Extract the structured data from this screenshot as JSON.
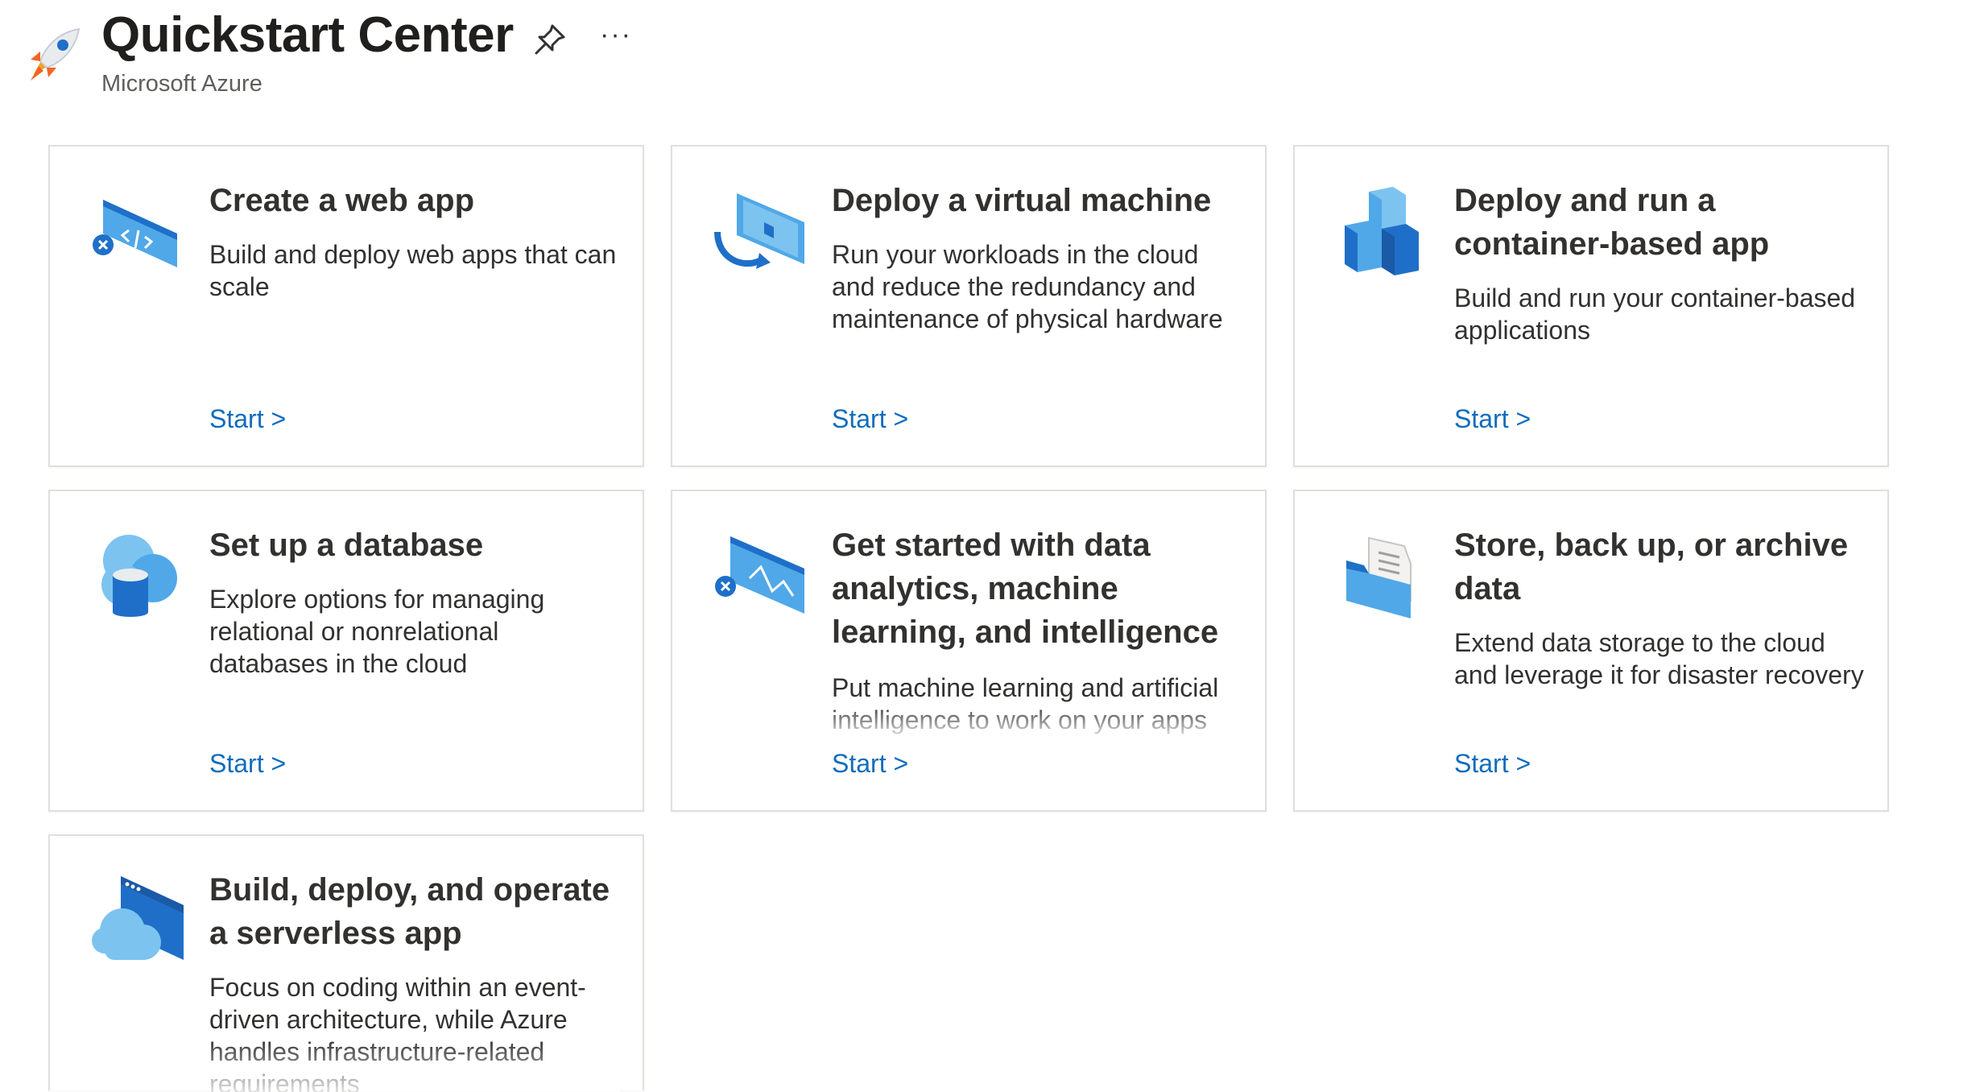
{
  "header": {
    "title": "Quickstart Center",
    "subtitle": "Microsoft Azure",
    "rocket_icon": "rocket-icon",
    "pin_icon": "pin-icon",
    "more_label": "···"
  },
  "cards": [
    {
      "title": "Create a web app",
      "description": "Build and deploy web apps that can scale",
      "start_label": "Start >",
      "icon": "web-app-icon"
    },
    {
      "title": "Deploy a virtual machine",
      "description": "Run your workloads in the cloud and reduce the redundancy and maintenance of physical hardware",
      "start_label": "Start >",
      "icon": "virtual-machine-icon"
    },
    {
      "title": "Deploy and run a container-based app",
      "description": "Build and run your container-based applications",
      "start_label": "Start >",
      "icon": "container-icon"
    },
    {
      "title": "Set up a database",
      "description": "Explore options for managing relational or nonrelational databases in the cloud",
      "start_label": "Start >",
      "icon": "database-icon"
    },
    {
      "title": "Get started with data analytics, machine learning, and intelligence",
      "description": "Put machine learning and artificial intelligence to work on your apps",
      "start_label": "Start >",
      "icon": "analytics-icon"
    },
    {
      "title": "Store, back up, or archive data",
      "description": "Extend data storage to the cloud and leverage it for disaster recovery",
      "start_label": "Start >",
      "icon": "storage-folder-icon"
    },
    {
      "title": "Build, deploy, and operate a serverless app",
      "description": "Focus on coding within an event-driven architecture, while Azure handles infrastructure-related requirements",
      "start_label": "",
      "icon": "serverless-icon"
    }
  ],
  "colors": {
    "accent": "#0f6cbd",
    "card_border": "#e1dfdd",
    "icon_blue": "#50a8e8",
    "icon_dark": "#1f6fc9"
  }
}
